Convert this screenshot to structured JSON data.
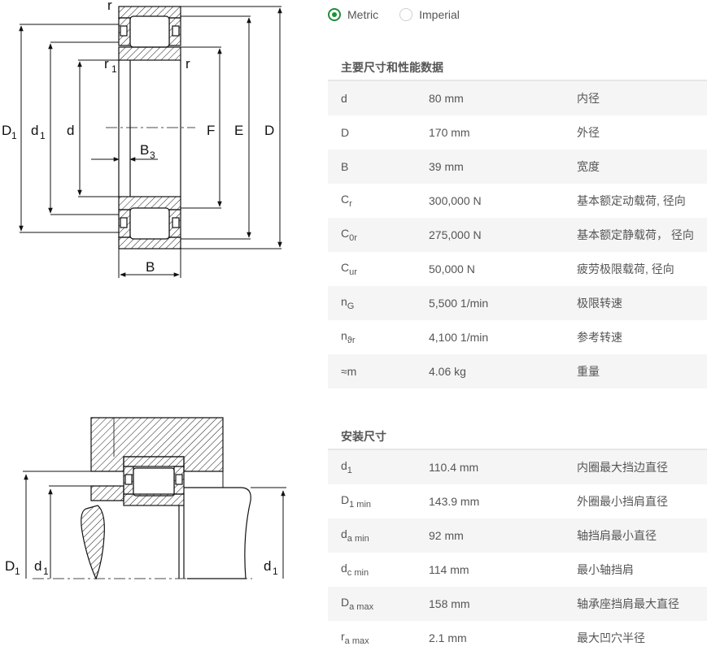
{
  "units": {
    "metric_label": "Metric",
    "imperial_label": "Imperial",
    "selected": "Metric"
  },
  "diagram_top": {
    "labels": {
      "r_top": "r",
      "r1": "r",
      "r1_sub": "1",
      "r_right": "r",
      "D1": "D",
      "D1_sub": "1",
      "d1": "d",
      "d1_sub": "1",
      "d": "d",
      "B3": "B",
      "B3_sub": "3",
      "F": "F",
      "E": "E",
      "D": "D",
      "B": "B"
    }
  },
  "diagram_bottom": {
    "labels": {
      "D1": "D",
      "D1_sub": "1",
      "d1_left": "d",
      "d1_left_sub": "1",
      "d1_right": "d",
      "d1_right_sub": "1"
    }
  },
  "main_specs": {
    "title": "主要尺寸和性能数据",
    "rows": [
      {
        "sym": "d",
        "sub": "",
        "value": "80 mm",
        "desc": "内径"
      },
      {
        "sym": "D",
        "sub": "",
        "value": "170 mm",
        "desc": "外径"
      },
      {
        "sym": "B",
        "sub": "",
        "value": "39 mm",
        "desc": "宽度"
      },
      {
        "sym": "C",
        "sub": "r",
        "value": "300,000 N",
        "desc": "基本额定动载荷, 径向"
      },
      {
        "sym": "C",
        "sub": "0r",
        "value": "275,000 N",
        "desc": "基本额定静载荷， 径向"
      },
      {
        "sym": "C",
        "sub": "ur",
        "value": "50,000 N",
        "desc": "疲劳极限载荷, 径向"
      },
      {
        "sym": "n",
        "sub": "G",
        "value": "5,500 1/min",
        "desc": "极限转速"
      },
      {
        "sym": "n",
        "sub": "ϑr",
        "value": "4,100 1/min",
        "desc": "参考转速"
      },
      {
        "sym": "≈m",
        "sub": "",
        "value": "4.06 kg",
        "desc": "重量"
      }
    ]
  },
  "mounting": {
    "title": "安装尺寸",
    "rows": [
      {
        "sym": "d",
        "sub": "1",
        "value": "110.4 mm",
        "desc": "内圈最大挡边直径"
      },
      {
        "sym": "D",
        "sub": "1 min",
        "value": "143.9 mm",
        "desc": "外圈最小挡肩直径"
      },
      {
        "sym": "d",
        "sub": "a min",
        "value": "92 mm",
        "desc": "轴挡肩最小直径"
      },
      {
        "sym": "d",
        "sub": "c min",
        "value": "114 mm",
        "desc": "最小轴挡肩"
      },
      {
        "sym": "D",
        "sub": "a max",
        "value": "158 mm",
        "desc": "轴承座挡肩最大直径"
      },
      {
        "sym": "r",
        "sub": "a max",
        "value": "2.1 mm",
        "desc": "最大凹穴半径"
      }
    ]
  }
}
